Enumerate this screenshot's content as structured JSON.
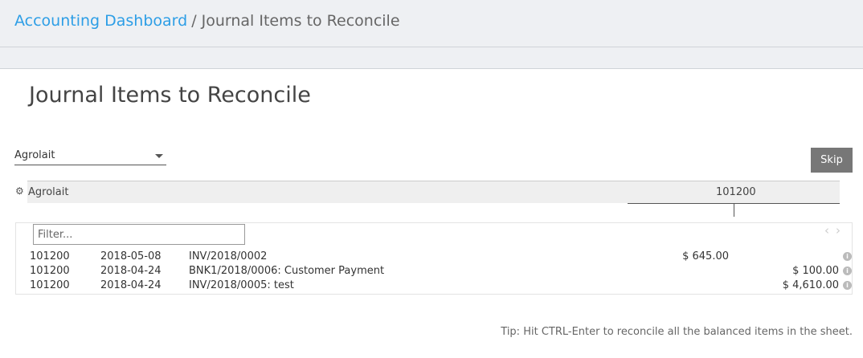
{
  "breadcrumb": {
    "parent": "Accounting Dashboard",
    "separator": "/",
    "current": "Journal Items to Reconcile"
  },
  "page_title": "Journal Items to Reconcile",
  "partner_select": {
    "value": "Agrolait"
  },
  "skip_label": "Skip",
  "account_line": {
    "partner": "Agrolait",
    "account": "101200"
  },
  "filter": {
    "placeholder": "Filter..."
  },
  "pager": {
    "prev": "‹",
    "next": "›"
  },
  "move_lines": [
    {
      "account": "101200",
      "date": "2018-05-08",
      "label": "INV/2018/0002",
      "debit": "$ 645.00",
      "credit": ""
    },
    {
      "account": "101200",
      "date": "2018-04-24",
      "label": "BNK1/2018/0006: Customer Payment",
      "debit": "",
      "credit": "$ 100.00"
    },
    {
      "account": "101200",
      "date": "2018-04-24",
      "label": "INV/2018/0005: test",
      "debit": "",
      "credit": "$ 4,610.00"
    }
  ],
  "tip": "Tip: Hit CTRL-Enter to reconcile all the balanced items in the sheet.",
  "icons": {
    "settings": "gear-icon",
    "info": "info-icon"
  },
  "colors": {
    "link": "#2d9ee6",
    "skip_button": "#777777"
  }
}
